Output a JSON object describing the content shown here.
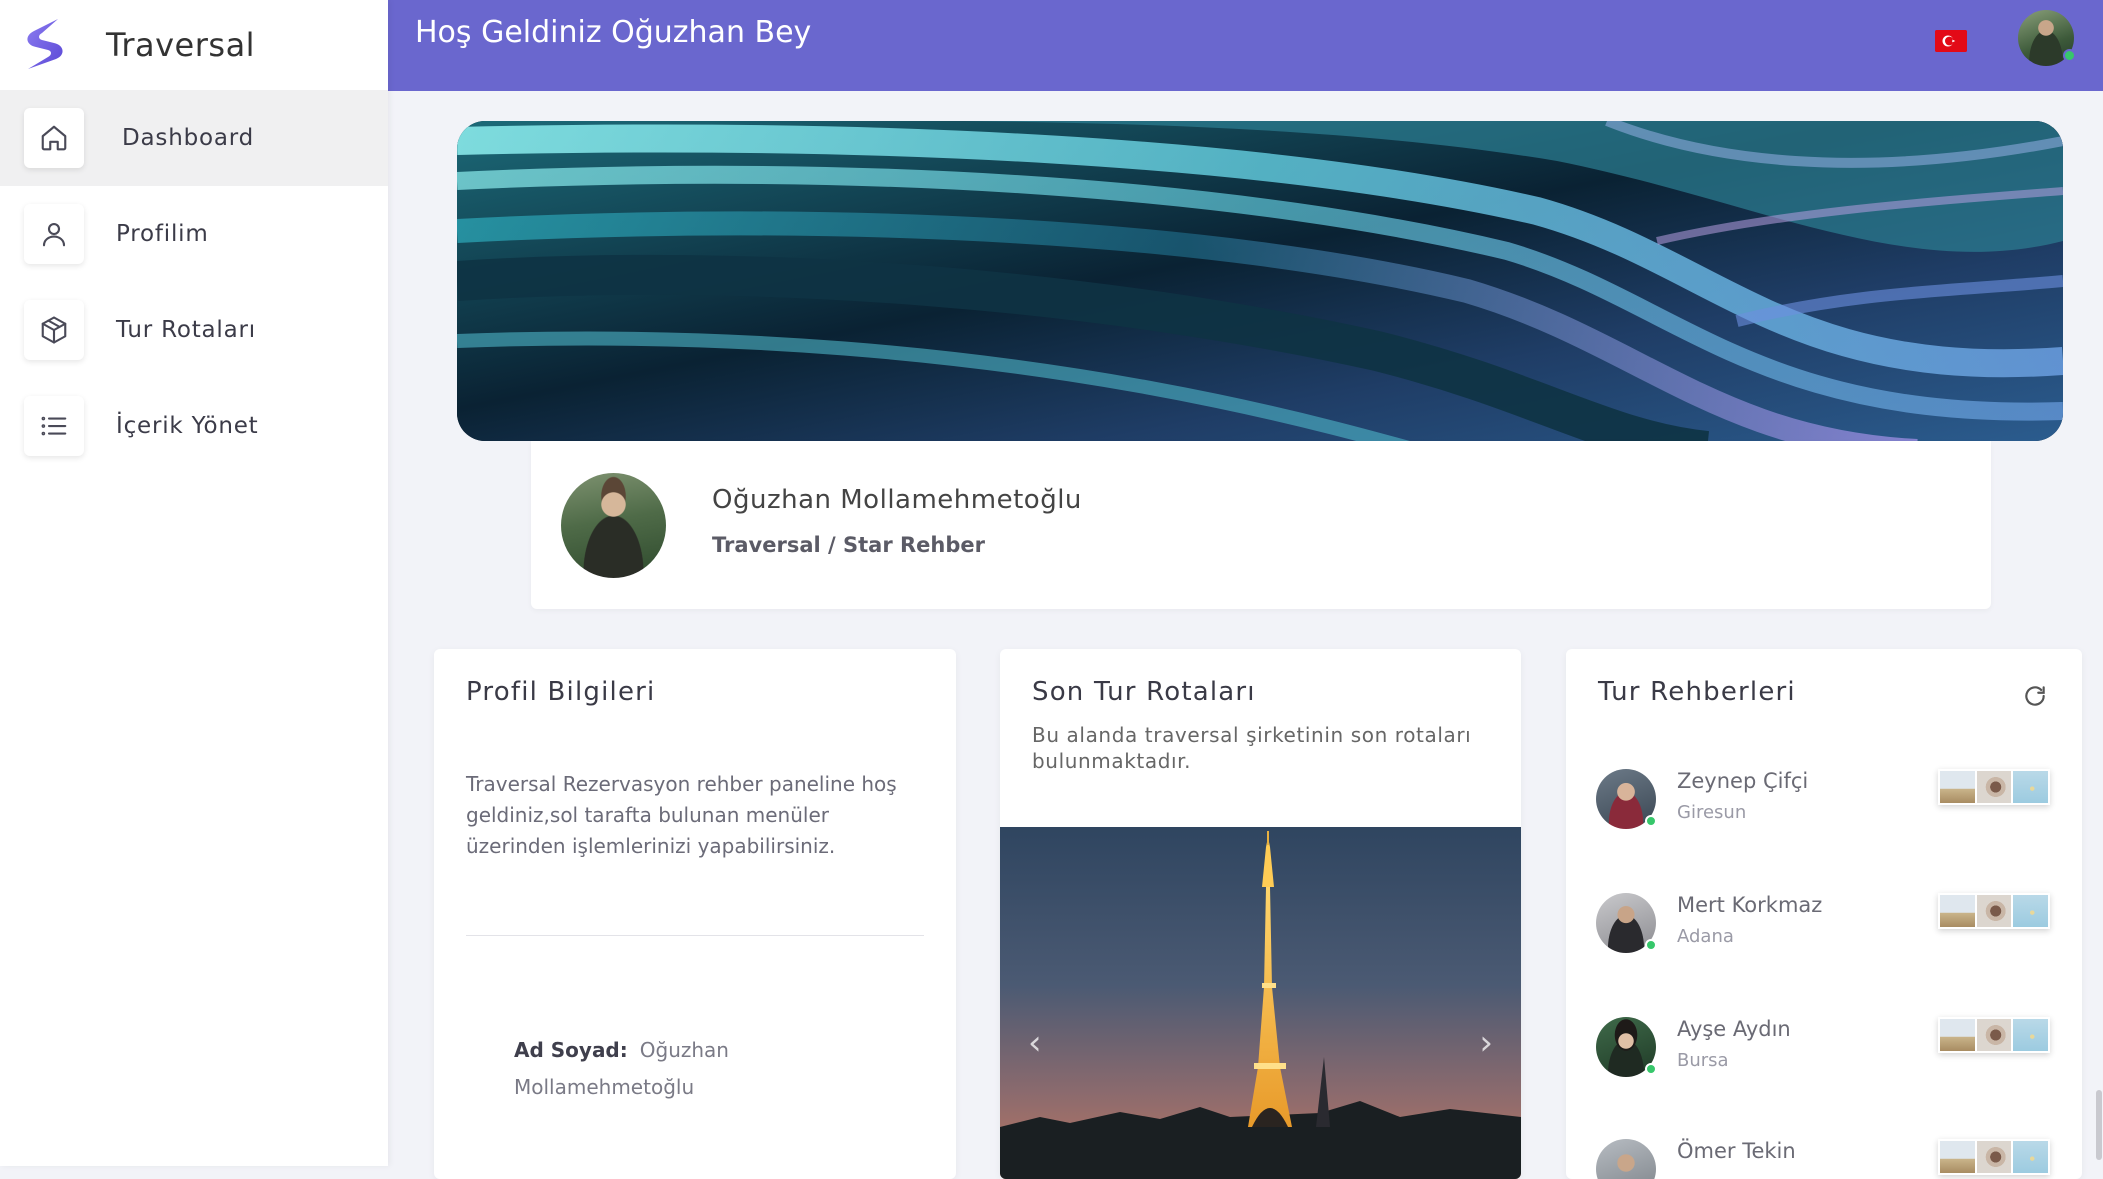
{
  "brand": {
    "name": "Traversal",
    "logo_icon": "s-logo-icon",
    "accent": "#6a67ce"
  },
  "sidebar": {
    "items": [
      {
        "label": "Dashboard",
        "icon": "home-icon",
        "active": true
      },
      {
        "label": "Profilim",
        "icon": "user-icon",
        "active": false
      },
      {
        "label": "Tur Rotaları",
        "icon": "package-icon",
        "active": false
      },
      {
        "label": "İçerik Yönet",
        "icon": "list-icon",
        "active": false
      }
    ]
  },
  "header": {
    "welcome": "Hoş Geldiniz Oğuzhan Bey",
    "flag_icon": "turkey-flag-icon",
    "avatar_status": "online"
  },
  "profile": {
    "name": "Oğuzhan Mollamehmetoğlu",
    "subtitle": "Traversal / Star Rehber"
  },
  "profile_info": {
    "title": "Profil Bilgileri",
    "description": "Traversal Rezervasyon rehber paneline hoş geldiniz,sol tarafta bulunan menüler üzerinden işlemlerinizi yapabilirsiniz.",
    "field_label": "Ad Soyad:",
    "field_value": "Oğuzhan Mollamehmetoğlu"
  },
  "routes": {
    "title": "Son Tur Rotaları",
    "subtitle": "Bu alanda traversal şirketinin son rotaları bulunmaktadır.",
    "prev_icon": "‹",
    "next_icon": "›"
  },
  "guides": {
    "title": "Tur Rehberleri",
    "items": [
      {
        "name": "Zeynep Çifçi",
        "city": "Giresun"
      },
      {
        "name": "Mert Korkmaz",
        "city": "Adana"
      },
      {
        "name": "Ayşe Aydın",
        "city": "Bursa"
      },
      {
        "name": "Ömer Tekin",
        "city": ""
      }
    ]
  }
}
